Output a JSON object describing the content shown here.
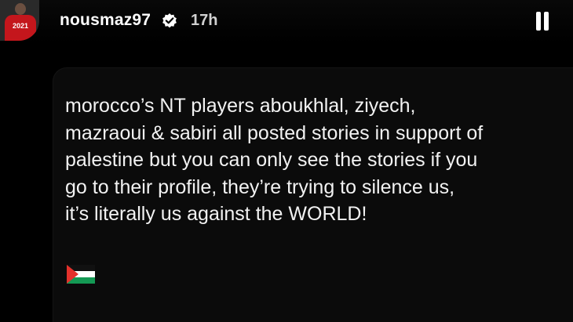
{
  "story": {
    "username": "nousmaz97",
    "time_ago": "17h",
    "avatar_shirt_text": "2021"
  },
  "post": {
    "lines": [
      "morocco’s NT players aboukhlal, ziyech,",
      "mazraoui & sabiri all posted stories in support of",
      "palestine but you can only see the stories if you",
      "go to their profile, they’re trying to silence us,",
      "it’s literally us against the WORLD!"
    ],
    "emoji": "palestine-flag-emoji"
  },
  "colors": {
    "background": "#000000",
    "text": "#f2f2f2",
    "card": "#0b0b0b",
    "flag_red": "#e4312b",
    "flag_green": "#149954"
  },
  "icons": {
    "verified": "verified-badge-icon",
    "pause": "pause-icon"
  }
}
